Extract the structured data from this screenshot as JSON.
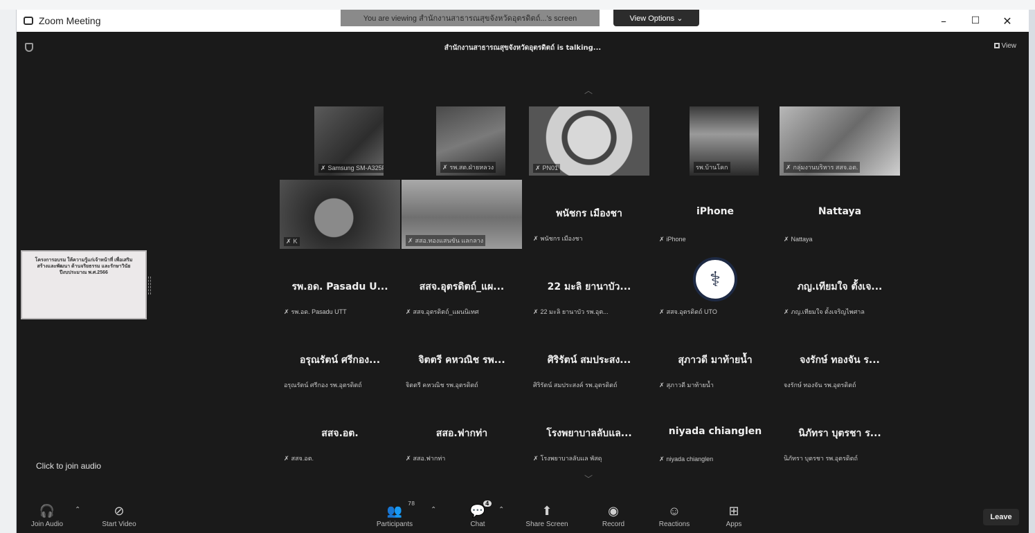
{
  "window": {
    "title": "Zoom Meeting",
    "viewing_banner": "You are viewing สำนักงานสาธารณสุขจังหวัดอุตรดิตถ์...'s screen",
    "view_options_label": "View Options ⌄",
    "minimize": "–",
    "maximize": "☐",
    "close": "✕"
  },
  "header": {
    "talking": "สำนักงานสาธารณสุขจังหวัดอุตรดิตถ์ is talking...",
    "view_label": "View"
  },
  "gallery": {
    "tiles": [
      {
        "kind": "video",
        "name": "Samsung SM-A325F",
        "mic_muted": true
      },
      {
        "kind": "video",
        "name": "รพ.สต.ฝ่ายหลวง",
        "mic_muted": true
      },
      {
        "kind": "video",
        "name": "PN01",
        "mic_muted": true
      },
      {
        "kind": "video",
        "name": "รพ.บ้านโคก",
        "mic_muted": false
      },
      {
        "kind": "video",
        "name": "กลุ่มงานบริหาร สสจ.อต.",
        "mic_muted": true
      },
      {
        "kind": "video",
        "name": "K",
        "mic_muted": true
      },
      {
        "kind": "video",
        "name": "สสอ.ทองแสนขัน แลกลาง",
        "mic_muted": true
      },
      {
        "kind": "name",
        "big": "พนัชกร เมืองชา",
        "name": "พนัชกร เมืองชา",
        "mic_muted": true
      },
      {
        "kind": "name",
        "big": "iPhone",
        "name": "iPhone",
        "mic_muted": true
      },
      {
        "kind": "name",
        "big": "Nattaya",
        "name": "Nattaya",
        "mic_muted": true
      },
      {
        "kind": "name",
        "big": "รพ.อด. Pasadu U...",
        "name": "รพ.อด. Pasadu UTT",
        "mic_muted": true
      },
      {
        "kind": "name",
        "big": "สสจ.อุตรดิตถ์_แผ...",
        "name": "สสจ.อุตรดิตถ์_แผนนิเทศ",
        "mic_muted": true
      },
      {
        "kind": "name",
        "big": "22 มะลิ ยานาบัว...",
        "name": "22 มะลิ ยานาบัว รพ.อุต...",
        "mic_muted": true
      },
      {
        "kind": "logo",
        "big": "",
        "name": "สสจ.อุตรดิตถ์ UTO",
        "mic_muted": true
      },
      {
        "kind": "name",
        "big": "ภญ.เทียมใจ ตั้งเจ...",
        "name": "ภญ.เทียมใจ ตั้งเจริญไพศาล",
        "mic_muted": true
      },
      {
        "kind": "name",
        "big": "อรุณรัตน์ ศรีกอง...",
        "name": "อรุณรัตน์ ศรีกอง รพ.อุตรดิตถ์",
        "mic_muted": false
      },
      {
        "kind": "name",
        "big": "จิตตรี คหวณิช รพ...",
        "name": "จิตตรี คหวณิช รพ.อุตรดิตถ์",
        "mic_muted": false
      },
      {
        "kind": "name",
        "big": "ศิริรัตน์ สมประสง...",
        "name": "ศิริรัตน์ สมประสงค์ รพ.อุตรดิตถ์",
        "mic_muted": false
      },
      {
        "kind": "name",
        "big": "สุภาวดี มาท้ายน้ำ",
        "name": "สุภาวดี มาท้ายน้ำ",
        "mic_muted": true
      },
      {
        "kind": "name",
        "big": "จงรักษ์ ทองจัน ร...",
        "name": "จงรักษ์ ทองจัน รพ.อุตรดิตถ์",
        "mic_muted": false
      },
      {
        "kind": "name",
        "big": "สสจ.อต.",
        "name": "สสจ.อต.",
        "mic_muted": true
      },
      {
        "kind": "name",
        "big": "สสอ.ฟากท่า",
        "name": "สสอ.ฟากท่า",
        "mic_muted": true
      },
      {
        "kind": "name",
        "big": "โรงพยาบาลลับแล...",
        "name": "โรงพยาบาลลับแล พัสดุ",
        "mic_muted": true
      },
      {
        "kind": "name",
        "big": "niyada chianglen",
        "name": "niyada chianglen",
        "mic_muted": true
      },
      {
        "kind": "name",
        "big": "นิภัทรา บุตรชา ร...",
        "name": "นิภัทรา บุตรชา รพ.อุตรดิตถ์",
        "mic_muted": false
      }
    ]
  },
  "shared_screen_thumbnail": {
    "text": "โครงการอบรม ให้ความรู้แก่เจ้าหน้าที่ เพื่อเสริมสร้างและพัฒนา ด้านจริยธรรม และรักษาวินัย ปีงบประมาณ พ.ศ.2566"
  },
  "join_audio_tip": "Click to join audio",
  "toolbar": {
    "join_audio": "Join Audio",
    "start_video": "Start Video",
    "participants": "Participants",
    "participants_count": "78",
    "chat": "Chat",
    "chat_badge": "4",
    "share_screen": "Share Screen",
    "record": "Record",
    "reactions": "Reactions",
    "apps": "Apps",
    "leave": "Leave"
  }
}
